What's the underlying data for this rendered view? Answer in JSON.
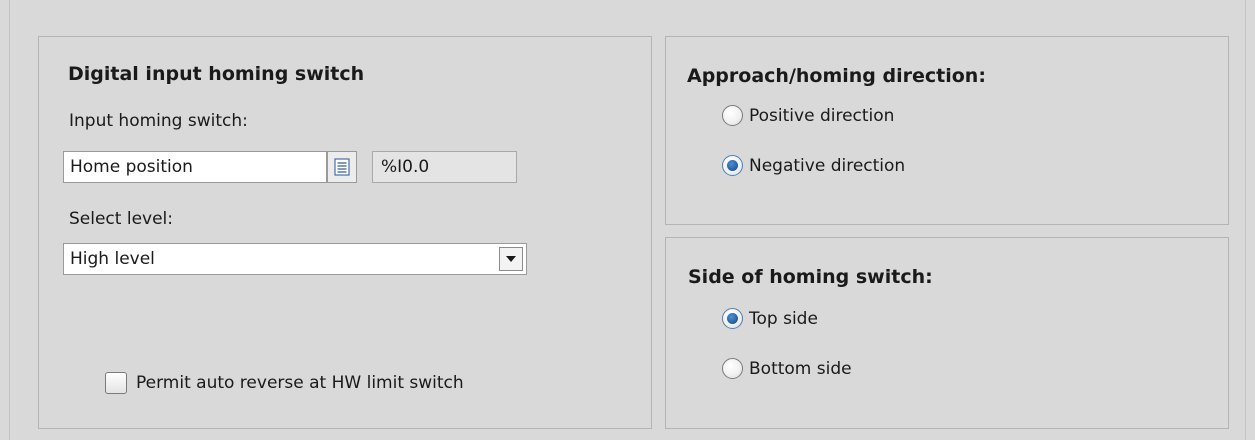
{
  "homing_switch": {
    "heading": "Digital input homing switch",
    "input_label": "Input homing switch:",
    "input_value": "Home position",
    "address_value": "%I0.0",
    "level_label": "Select level:",
    "level_value": "High level",
    "auto_reverse_label": "Permit auto reverse at HW limit switch",
    "auto_reverse_checked": false
  },
  "approach_direction": {
    "heading": "Approach/homing direction:",
    "options": [
      {
        "label": "Positive direction",
        "selected": false
      },
      {
        "label": "Negative direction",
        "selected": true
      }
    ]
  },
  "switch_side": {
    "heading": "Side of homing switch:",
    "options": [
      {
        "label": "Top side",
        "selected": true
      },
      {
        "label": "Bottom side",
        "selected": false
      }
    ]
  },
  "icons": {
    "list_button": "list-icon",
    "dropdown": "triangle-down-icon"
  },
  "colors": {
    "background": "#d9d9d9",
    "panel_border": "#b4b4b4",
    "radio_selected": "#1f5d9e"
  }
}
